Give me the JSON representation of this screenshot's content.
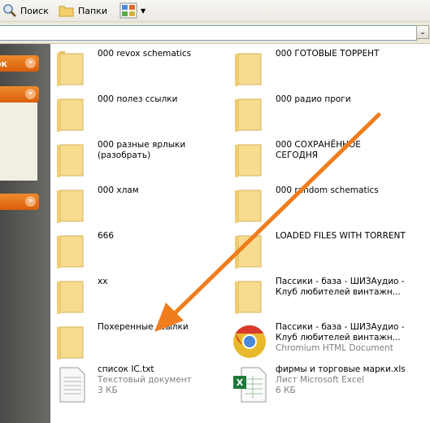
{
  "toolbar": {
    "search_label": "Поиск",
    "folders_label": "Папки"
  },
  "sidebar": {
    "section1_label": "ок"
  },
  "files": [
    {
      "name": "000 revox schematics",
      "type": "folder"
    },
    {
      "name": "000 ГОТОВЫЕ ТОРРЕНТ",
      "type": "folder"
    },
    {
      "name": "000 полез ссылки",
      "type": "folder"
    },
    {
      "name": "000 радио проги",
      "type": "folder"
    },
    {
      "name": "000 разные ярлыки (разобрать)",
      "type": "folder"
    },
    {
      "name": "000 СОХРАНЁННОЕ СЕГОДНЯ",
      "type": "folder"
    },
    {
      "name": "000 хлам",
      "type": "folder"
    },
    {
      "name": "000 random schematics",
      "type": "folder"
    },
    {
      "name": "666",
      "type": "folder"
    },
    {
      "name": "LOADED FILES WITH TORRENT",
      "type": "folder"
    },
    {
      "name": "xx",
      "type": "folder"
    },
    {
      "name": "Пассики - база - ШИЗАудио - Клуб любителей винтажн...",
      "type": "folder"
    },
    {
      "name": "Похеренные ссылки",
      "type": "folder"
    },
    {
      "name": "Пассики - база - ШИЗАудио - Клуб любителей винтажн...",
      "type": "chromium",
      "kind": "Chromium HTML Document"
    },
    {
      "name": "список IC.txt",
      "type": "text",
      "kind": "Текстовый документ",
      "size": "3 КБ"
    },
    {
      "name": "фирмы и торговые марки.xls",
      "type": "excel",
      "kind": "Лист Microsoft Excel",
      "size": "6 КБ"
    }
  ],
  "colors": {
    "arrow": "#f07c1c",
    "sidebar_accent": "#e8701a",
    "folder": "#f3d78a"
  }
}
